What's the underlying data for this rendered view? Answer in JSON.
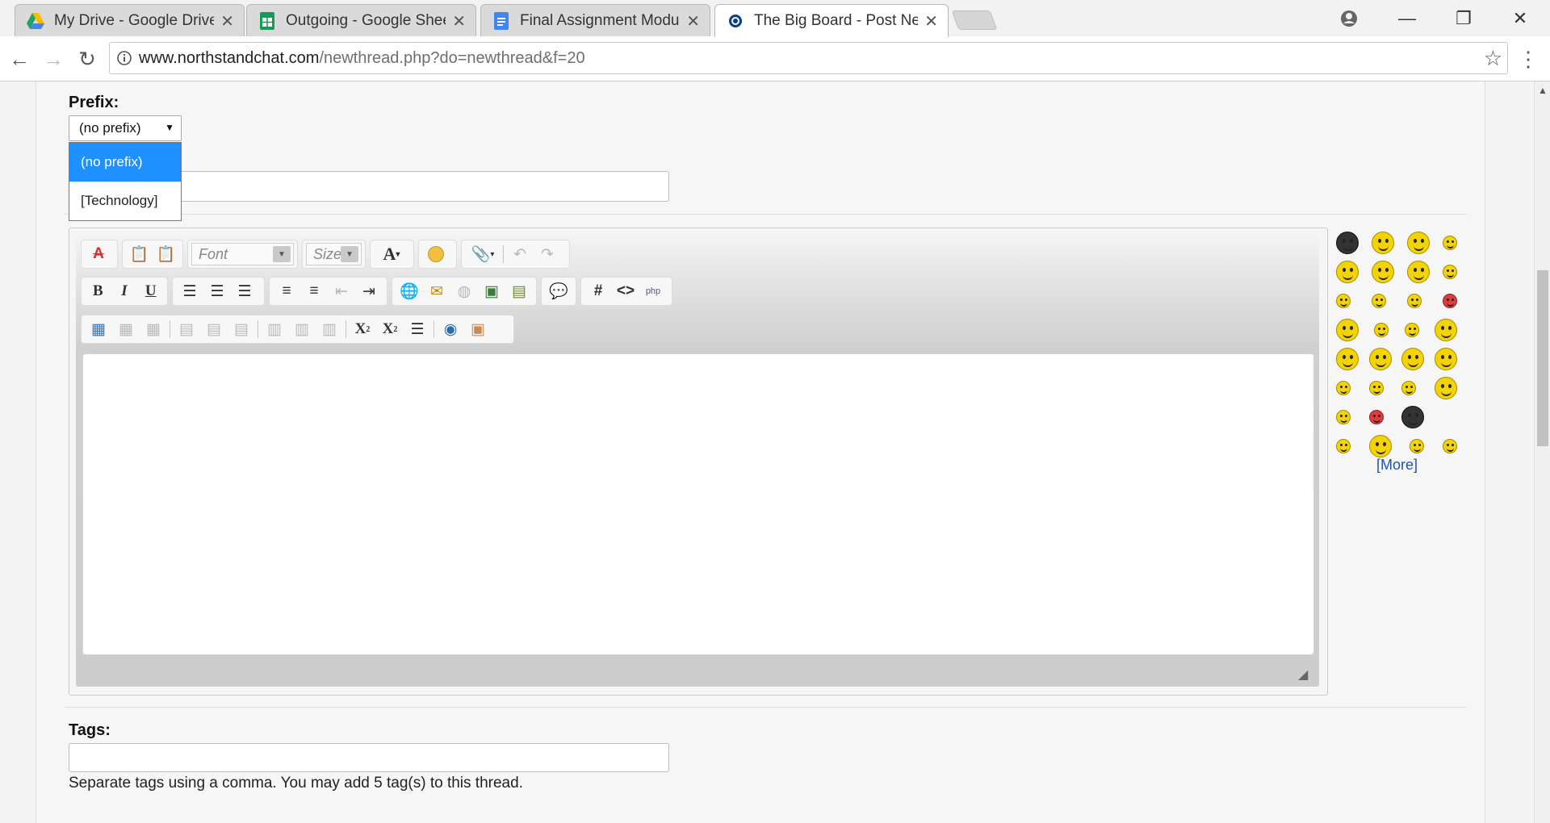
{
  "browser": {
    "tabs": [
      {
        "title": "My Drive - Google Drive",
        "icon": "google-drive-icon"
      },
      {
        "title": "Outgoing - Google Sheets",
        "icon": "google-sheets-icon"
      },
      {
        "title": "Final Assignment Module",
        "icon": "google-docs-icon"
      },
      {
        "title": "The Big Board - Post New Thread",
        "icon": "site-favicon"
      }
    ],
    "url_host": "www.northstandchat.com",
    "url_path": "/newthread.php?do=newthread&f=20"
  },
  "form": {
    "prefix_label": "Prefix:",
    "prefix_value": "(no prefix)",
    "prefix_options": [
      "(no prefix)",
      "[Technology]"
    ],
    "editor": {
      "font_placeholder": "Font",
      "size_placeholder": "Size"
    },
    "smilies_more": "[More]",
    "tags_label": "Tags:",
    "tags_help": "Separate tags using a comma. You may add 5 tag(s) to this thread."
  },
  "colors": {
    "selected_option": "#1e90ff",
    "link": "#1f55a8"
  }
}
